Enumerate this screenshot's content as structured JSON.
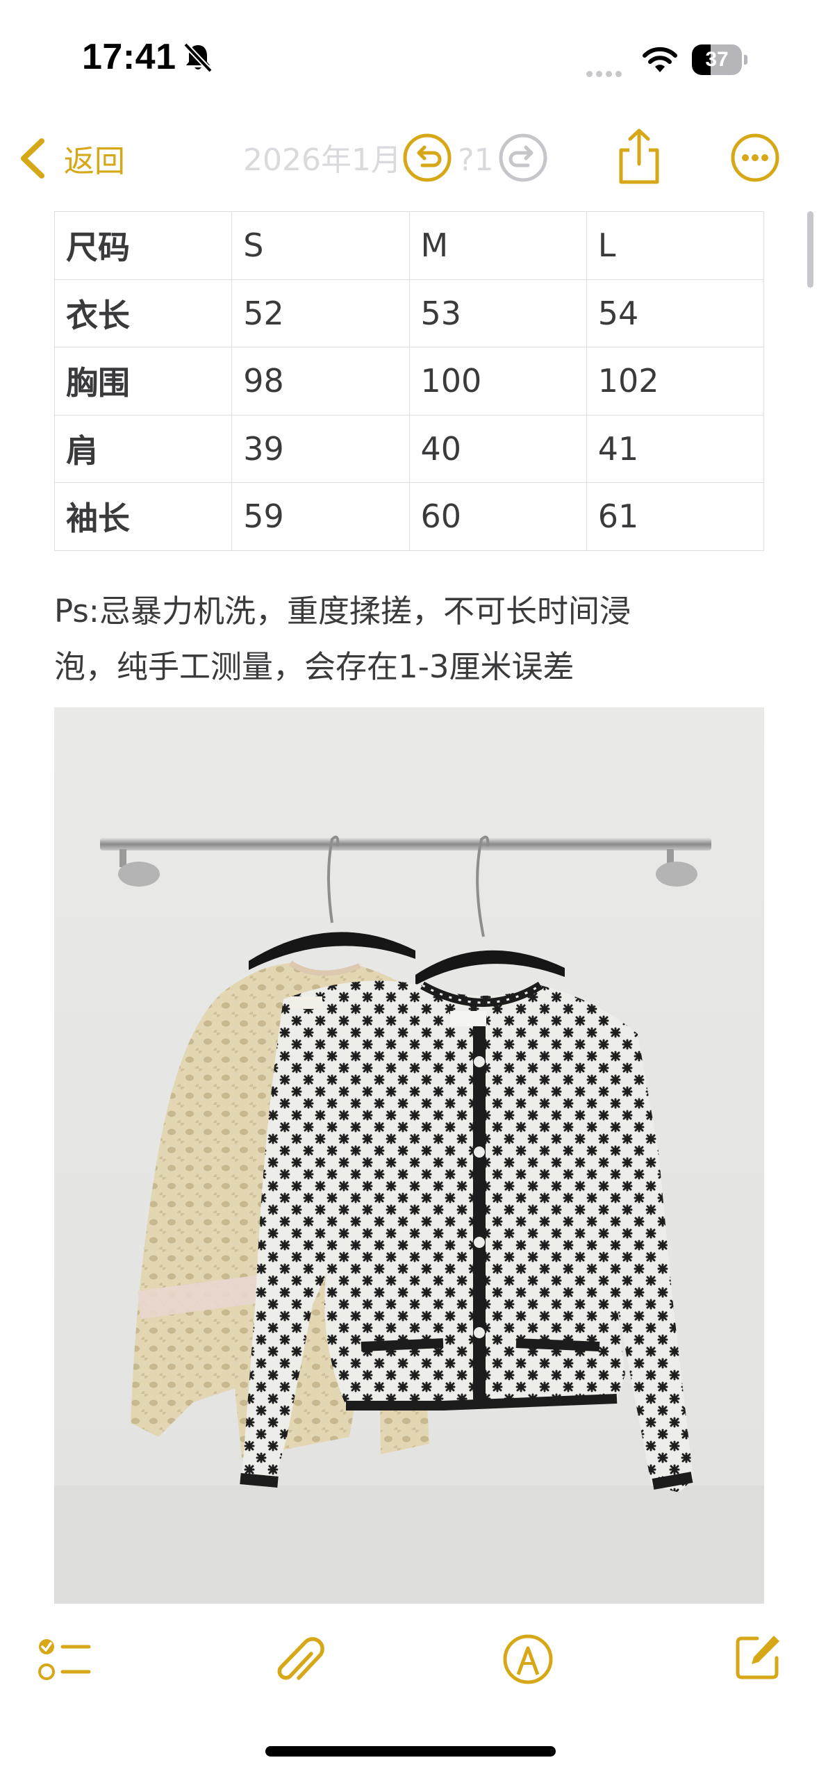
{
  "status_bar": {
    "time": "17:41",
    "battery_level": "37",
    "battery_fraction": 0.37,
    "icons": [
      "bell-slash-icon",
      "cellular-dots-icon",
      "wifi-icon",
      "battery-icon"
    ]
  },
  "nav": {
    "back_label": "返回",
    "title_partial": "2026年1月?日 ?1",
    "icons": [
      "chevron-left-icon",
      "undo-icon",
      "redo-icon",
      "share-icon",
      "more-icon"
    ]
  },
  "size_table": {
    "header": [
      "尺码",
      "S",
      "M",
      "L"
    ],
    "rows": [
      [
        "衣长",
        "52",
        "53",
        "54"
      ],
      [
        "胸围",
        "98",
        "100",
        "102"
      ],
      [
        "肩",
        "39",
        "40",
        "41"
      ],
      [
        "袖长",
        "59",
        "60",
        "61"
      ]
    ]
  },
  "note": {
    "line1": "Ps:忌暴力机洗，重度揉搓，不可长时间浸",
    "line2": "泡，纯手工测量，会存在1-3厘米误差"
  },
  "photo": {
    "subject": "two-knit-cardigans-on-wall-rack",
    "left_color": "#e0d2ad",
    "right_color": "#ededea",
    "pattern_color": "#1e1e1e"
  },
  "toolbar": {
    "icons": [
      "checklist-icon",
      "paperclip-icon",
      "markup-pen-icon",
      "compose-icon"
    ]
  },
  "colors": {
    "accent": "#d6a817",
    "text": "#3a3a3c",
    "border": "#dedee2",
    "disabled": "#c6c6ca"
  }
}
